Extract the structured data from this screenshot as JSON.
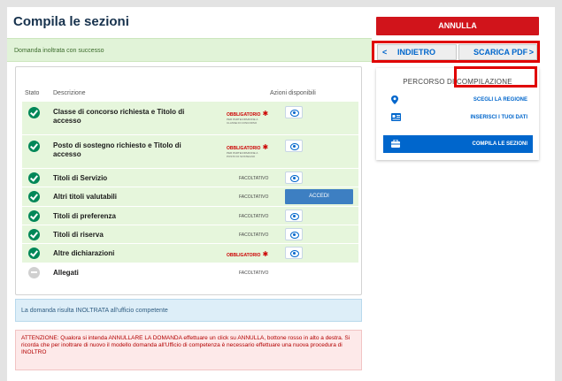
{
  "page": {
    "title": "Compila le sezioni",
    "success_message": "Domanda inoltrata con successo"
  },
  "table": {
    "headers": {
      "stato": "Stato",
      "descrizione": "Descrizione",
      "azioni": "Azioni disponibili"
    },
    "rows": [
      {
        "status": "completed",
        "description": "Classe di concorso richiesta e Titolo di accesso",
        "requirement": "OBBLIGATORIO",
        "requirement_note": "PER PARTECIPAZIONE A CLASSE DI CONCORSO",
        "action": "view"
      },
      {
        "status": "completed",
        "description": "Posto di sostegno richiesto e Titolo di accesso",
        "requirement": "OBBLIGATORIO",
        "requirement_note": "PER PARTECIPAZIONE A POSTO DI SOSTEGNO",
        "action": "view"
      },
      {
        "status": "completed",
        "description": "Titoli di Servizio",
        "requirement": "FACOLTATIVO",
        "requirement_note": "",
        "action": "view"
      },
      {
        "status": "completed",
        "description": "Altri titoli valutabili",
        "requirement": "FACOLTATIVO",
        "requirement_note": "",
        "action": "accedi",
        "action_label": "ACCEDI"
      },
      {
        "status": "completed",
        "description": "Titoli di preferenza",
        "requirement": "FACOLTATIVO",
        "requirement_note": "",
        "action": "view"
      },
      {
        "status": "completed",
        "description": "Titoli di riserva",
        "requirement": "FACOLTATIVO",
        "requirement_note": "",
        "action": "view"
      },
      {
        "status": "completed",
        "description": "Altre dichiarazioni",
        "requirement": "OBBLIGATORIO",
        "requirement_note": "",
        "action": "view"
      },
      {
        "status": "neutral",
        "description": "Allegati",
        "requirement": "FACOLTATIVO",
        "requirement_note": "",
        "action": "none"
      }
    ]
  },
  "info_message": "La domanda risulta INOLTRATA all'ufficio competente",
  "warning_message": "ATTENZIONE: Qualora si intenda ANNULLARE LA DOMANDA effettuare un click su ANNULLA, bottone rosso in alto a destra. Si ricorda che per inoltrare di nuovo il modello domanda all'Ufficio di competenza è necessario effettuare una nuova procedura di INOLTRO",
  "sidebar": {
    "annulla_label": "ANNULLA",
    "indietro_label": "INDIETRO",
    "scarica_label": "SCARICA PDF",
    "percorso_prefix": "PERCORSO DI",
    "percorso_suffix": "COMPILAZIONE",
    "steps": [
      {
        "label": "SCEGLI LA REGIONE",
        "icon": "map-pin-icon",
        "active": false
      },
      {
        "label": "INSERISCI I TUOI DATI",
        "icon": "id-card-icon",
        "active": false
      },
      {
        "label": "COMPILA LE SEZIONI",
        "icon": "briefcase-icon",
        "active": true
      }
    ]
  },
  "colors": {
    "success_row": "#e6f6dc",
    "primary": "#0066cc",
    "danger": "#d1141b",
    "check": "#008758"
  }
}
